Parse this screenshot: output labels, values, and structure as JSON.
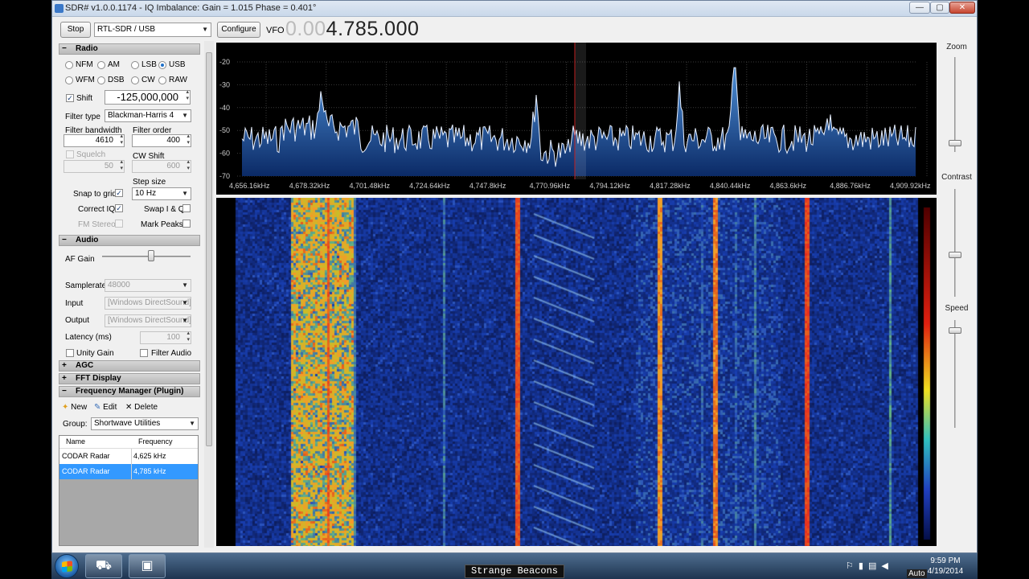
{
  "window": {
    "title": "SDR# v1.0.0.1174 - IQ Imbalance: Gain = 1.015 Phase = 0.401°",
    "min_glyph": "—",
    "max_glyph": "▢",
    "close_glyph": "✕"
  },
  "toolbar": {
    "stop_label": "Stop",
    "source": "RTL-SDR / USB",
    "configure_label": "Configure",
    "vfo_label": "VFO",
    "vfo_dim": "0.00",
    "vfo_value": "4.785.000"
  },
  "radio": {
    "header": "Radio",
    "modes": [
      {
        "label": "NFM",
        "selected": false
      },
      {
        "label": "AM",
        "selected": false
      },
      {
        "label": "LSB",
        "selected": false
      },
      {
        "label": "USB",
        "selected": true
      },
      {
        "label": "WFM",
        "selected": false
      },
      {
        "label": "DSB",
        "selected": false
      },
      {
        "label": "CW",
        "selected": false
      },
      {
        "label": "RAW",
        "selected": false
      }
    ],
    "shift_label": "Shift",
    "shift_value": "-125,000,000",
    "filter_type_label": "Filter type",
    "filter_type": "Blackman-Harris 4",
    "filter_bandwidth_label": "Filter bandwidth",
    "filter_bandwidth": "4610",
    "filter_order_label": "Filter order",
    "filter_order": "400",
    "squelch_label": "Squelch",
    "squelch_value": "50",
    "cw_shift_label": "CW Shift",
    "cw_shift_value": "600",
    "step_size_label": "Step size",
    "step_size": "10 Hz",
    "snap_to_grid_label": "Snap to grid",
    "correct_iq_label": "Correct IQ",
    "swap_iq_label": "Swap I & Q",
    "fm_stereo_label": "FM Stereo",
    "mark_peaks_label": "Mark Peaks",
    "check_glyph": "✓"
  },
  "audio": {
    "header": "Audio",
    "af_gain_label": "AF Gain",
    "af_gain_level": 0.55,
    "samplerate_label": "Samplerate",
    "samplerate": "48000",
    "input_label": "Input",
    "input": "[Windows DirectSound]",
    "output_label": "Output",
    "output": "[Windows DirectSound]",
    "latency_label": "Latency (ms)",
    "latency": "100",
    "unity_gain_label": "Unity Gain",
    "filter_audio_label": "Filter Audio"
  },
  "agc": {
    "header": "AGC"
  },
  "fft": {
    "header": "FFT Display"
  },
  "freq_manager": {
    "header": "Frequency Manager (Plugin)",
    "new_label": "New",
    "edit_label": "Edit",
    "delete_label": "Delete",
    "group_label": "Group:",
    "group": "Shortwave Utilities",
    "col_name": "Name",
    "col_frequency": "Frequency",
    "rows": [
      {
        "name": "CODAR Radar",
        "frequency": "4,625 kHz"
      },
      {
        "name": "CODAR Radar",
        "frequency": "4,785 kHz"
      }
    ]
  },
  "section_glyphs": {
    "minus": "−",
    "plus": "+"
  },
  "spectrum": {
    "y_ticks": [
      "-20",
      "-30",
      "-40",
      "-50",
      "-60",
      "-70"
    ],
    "x_ticks": [
      "4,656.16kHz",
      "4,678.32kHz",
      "4,701.48kHz",
      "4,724.64kHz",
      "4,747.8kHz",
      "4,770.96kHz",
      "4,794.12kHz",
      "4,817.28kHz",
      "4,840.44kHz",
      "4,863.6kHz",
      "4,886.76kHz",
      "4,909.92kHz"
    ]
  },
  "right_panel": {
    "zoom_label": "Zoom",
    "contrast_label": "Contrast",
    "speed_label": "Speed"
  },
  "taskbar": {
    "caption": "Strange Beacons",
    "time": "9:59 PM",
    "date": "4/19/2014",
    "overlay": "Auto"
  },
  "colors": {
    "accent": "#3399ff",
    "spectrum_fill": "#1d5aa8",
    "waterfall_bg": "#0a1040"
  }
}
